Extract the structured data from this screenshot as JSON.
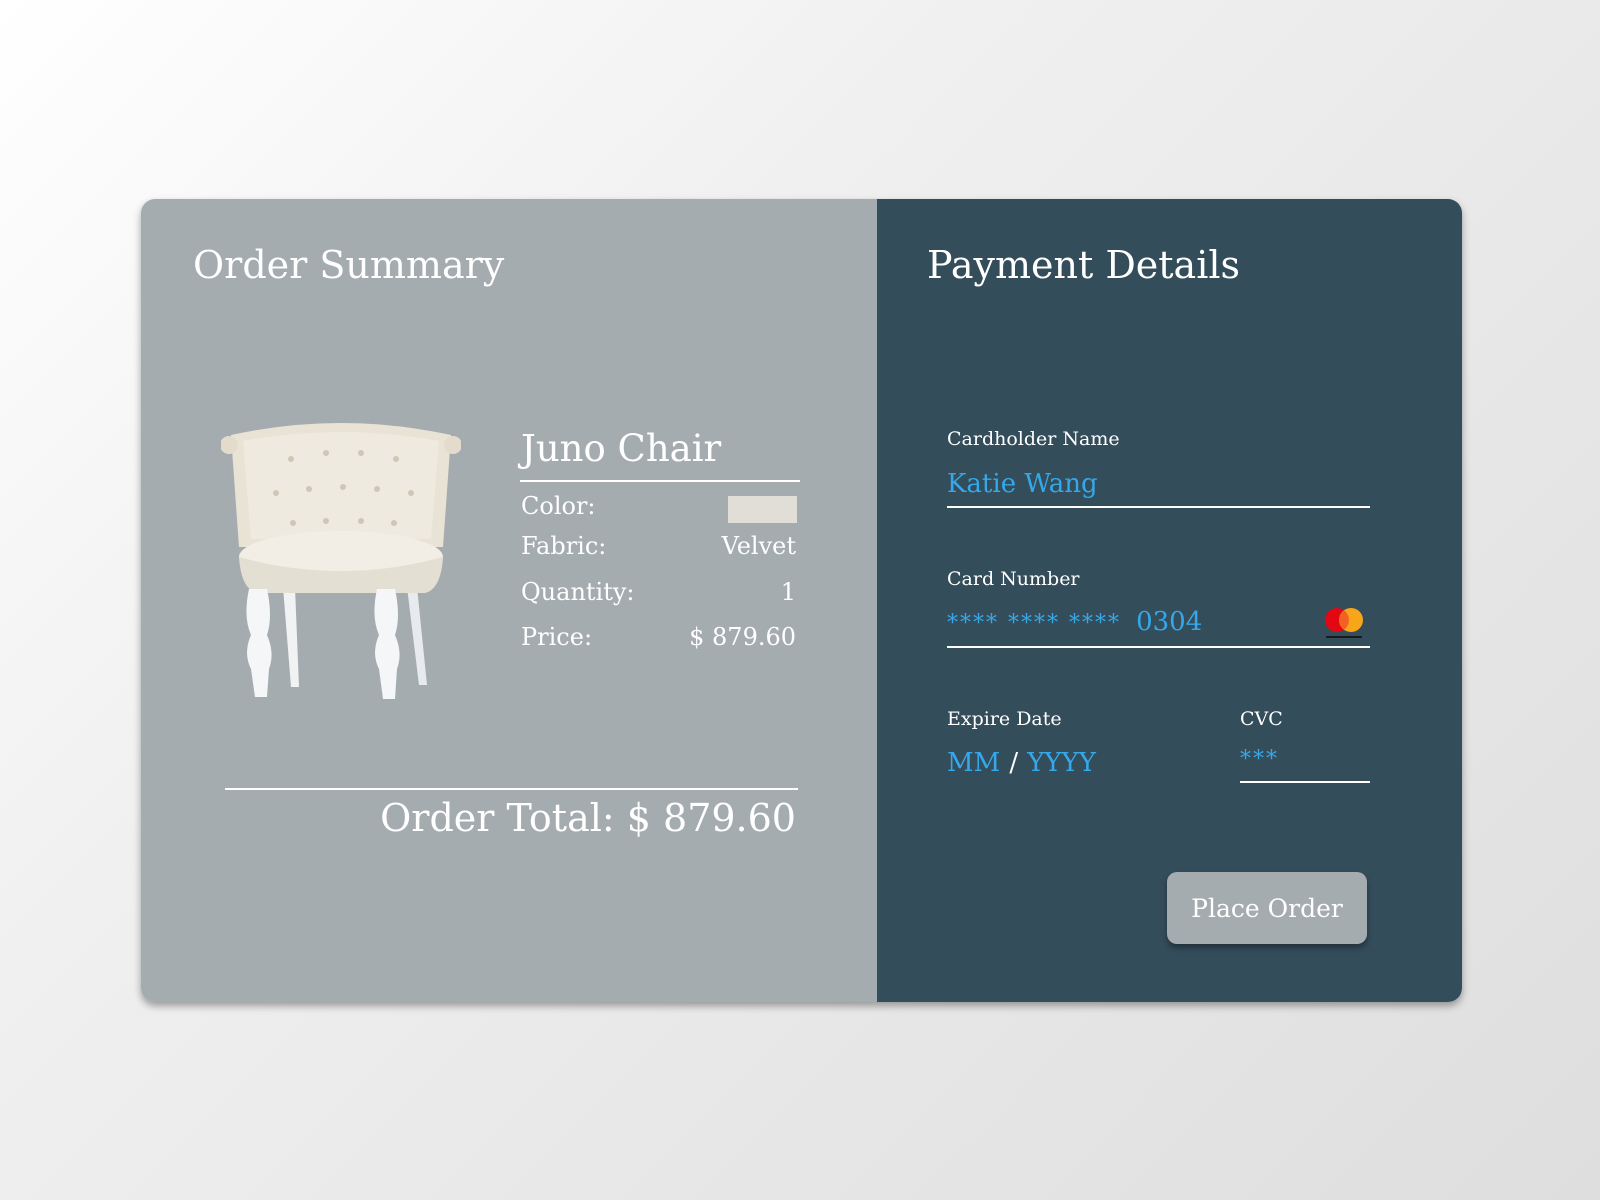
{
  "order_summary": {
    "heading": "Order Summary",
    "product": {
      "name": "Juno Chair",
      "color_label": "Color:",
      "color_swatch": "#e0ded7",
      "fabric_label": "Fabric:",
      "fabric_value": "Velvet",
      "quantity_label": "Quantity:",
      "quantity_value": "1",
      "price_label": "Price:",
      "price_value": "$ 879.60"
    },
    "total_text": "Order Total: $ 879.60"
  },
  "payment": {
    "heading": "Payment Details",
    "cardholder_label": "Cardholder Name",
    "cardholder_value": "Katie Wang",
    "card_number_label": "Card Number",
    "card_number_masked": "**** **** ****",
    "card_number_last4": "0304",
    "card_brand_icon": "mastercard-icon",
    "expire_label": "Expire Date",
    "expire_month_placeholder": "MM",
    "expire_separator": "/",
    "expire_year_placeholder": "YYYY",
    "cvc_label": "CVC",
    "cvc_value": "***",
    "place_order_label": "Place Order"
  },
  "colors": {
    "left_panel": "#a5acb0",
    "right_panel": "#344d5b",
    "accent": "#34a8ea",
    "text": "#ffffff"
  }
}
